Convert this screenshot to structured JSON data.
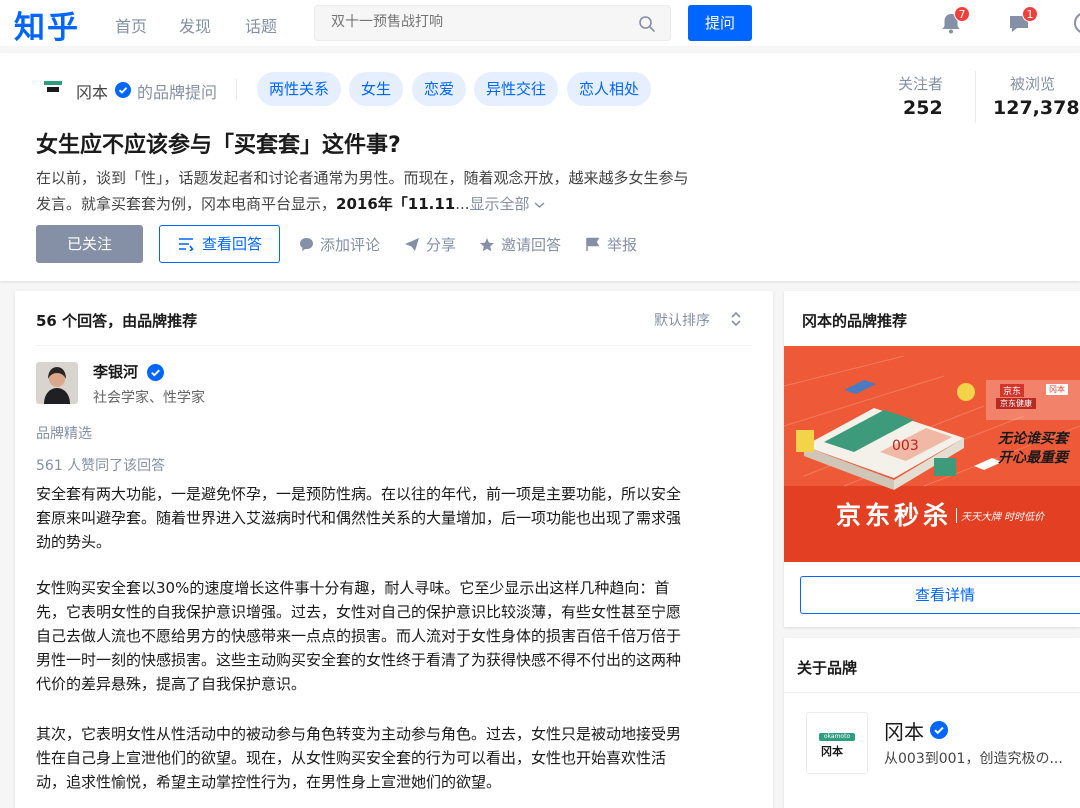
{
  "nav": {
    "logo": "知乎",
    "items": [
      "首页",
      "发现",
      "话题"
    ],
    "search_placeholder": "双十一预售战打响",
    "ask_label": "提问",
    "notifications_count": "7",
    "messages_count": "1"
  },
  "question": {
    "brand_name": "冈本",
    "brand_suffix": "的品牌提问",
    "tags": [
      "两性关系",
      "女生",
      "恋爱",
      "异性交往",
      "恋人相处"
    ],
    "followers_label": "关注者",
    "followers": "252",
    "views_label": "被浏览",
    "views": "127,378",
    "title": "女生应不应该参与「买套套」这件事?",
    "desc_line1": "在以前，谈到「性」，话题发起者和讨论者通常为男性。而现在，随着观念开放，越来越多女生参与",
    "desc_line2_prefix": "发言。就拿买套套为例，冈本电商平台显示，",
    "desc_line2_bold": "2016年「11.11",
    "desc_line2_ellipsis": "...",
    "show_all": "显示全部",
    "followed_label": "已关注",
    "view_answers_label": "查看回答",
    "actions": [
      "添加评论",
      "分享",
      "邀请回答",
      "举报"
    ]
  },
  "answers": {
    "count_label": "56 个回答，由品牌推荐",
    "sort_label": "默认排序",
    "author_name": "李银河",
    "author_bio": "社会学家、性学家",
    "pick_label": "品牌精选",
    "likes_label": "561 人赞同了该回答",
    "p1_l1": "安全套有两大功能，一是避免怀孕，一是预防性病。在以往的年代，前一项是主要功能，所以安全",
    "p1_l2": "套原来叫避孕套。随着世界进入艾滋病时代和偶然性关系的大量增加，后一项功能也出现了需求强",
    "p1_l3": "劲的势头。",
    "p2_l1": "女性购买安全套以30%的速度增长这件事十分有趣，耐人寻味。它至少显示出这样几种趋向：首",
    "p2_l2": "先，它表明女性的自我保护意识增强。过去，女性对自己的保护意识比较淡薄，有些女性甚至宁愿",
    "p2_l3": "自己去做人流也不愿给男方的快感带来一点点的损害。而人流对于女性身体的损害百倍千倍万倍于",
    "p2_l4": "男性一时一刻的快感损害。这些主动购买安全套的女性终于看清了为获得快感不得不付出的这两种",
    "p2_l5": "代价的差异悬殊，提高了自我保护意识。",
    "p3_l1": "其次，它表明女性从性活动中的被动参与角色转变为主动参与角色。过去，女性只是被动地接受男",
    "p3_l2": "性在自己身上宣泄他们的欲望。现在，从女性购买安全套的行为可以看出，女性也开始喜欢性活",
    "p3_l3": "动，追求性愉悦，希望主动掌控性行为，在男性身上宣泄她们的欲望。"
  },
  "sidebar": {
    "recommend_title": "冈本的品牌推荐",
    "ad_main": "京东秒杀",
    "ad_sub": "天天大牌 时时低价",
    "ad_slogan_1": "无论谁买套",
    "ad_slogan_2": "开心最重要",
    "ad_jd": "京东",
    "ad_brand": "冈本",
    "ad_health": "京东健康",
    "ad_box_text": "003",
    "detail_label": "查看详情",
    "about_title": "关于品牌",
    "brand_name": "冈本",
    "brand_logo_en": "okamoto",
    "brand_logo_cn": "冈本",
    "brand_desc": "从003到001，创造究极の..."
  },
  "colors": {
    "accent": "#0066ff",
    "tag_bg": "#e5efff",
    "muted": "#8590a6",
    "badge": "#f1403c",
    "ad_red": "#ea4a2c"
  }
}
